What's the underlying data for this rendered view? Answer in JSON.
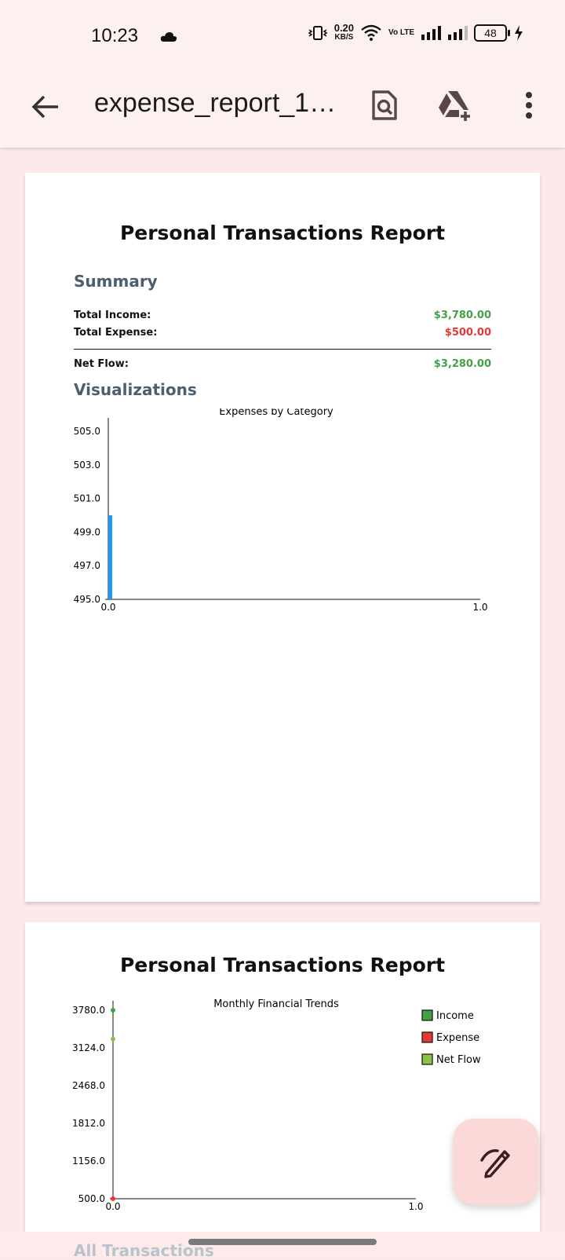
{
  "status_bar": {
    "time": "10:23",
    "net_speed_value": "0.20",
    "net_speed_unit": "KB/S",
    "lte_top": "Vo LTE",
    "battery": "48"
  },
  "toolbar": {
    "title": "expense_report_1…"
  },
  "page1": {
    "title": "Personal Transactions Report",
    "summary_heading": "Summary",
    "rows": [
      {
        "label": "Total Income:",
        "value": "$3,780.00",
        "color": "#43a047"
      },
      {
        "label": "Total Expense:",
        "value": "$500.00",
        "color": "#e53935"
      }
    ],
    "net_label": "Net Flow:",
    "net_value": "$3,280.00",
    "visualizations_heading": "Visualizations"
  },
  "page2": {
    "title": "Personal Transactions Report"
  },
  "next_section_heading": "All Transactions",
  "chart_data": [
    {
      "type": "bar",
      "title": "Expenses by Category",
      "xlabel": "",
      "ylabel": "",
      "x_ticks": [
        "0.0",
        "1.0"
      ],
      "y_ticks": [
        "505.0",
        "503.0",
        "501.0",
        "499.0",
        "497.0",
        "495.0"
      ],
      "xlim": [
        0,
        1
      ],
      "ylim": [
        495,
        505.8
      ],
      "x": [
        0.0
      ],
      "values": [
        500
      ],
      "bar_color": "#2196f3"
    },
    {
      "type": "line",
      "title": "Monthly Financial Trends",
      "xlabel": "",
      "ylabel": "",
      "x_ticks": [
        "0.0",
        "1.0"
      ],
      "y_ticks": [
        "3780.0",
        "3124.0",
        "2468.0",
        "1812.0",
        "1156.0",
        "500.0"
      ],
      "xlim": [
        0,
        1
      ],
      "ylim": [
        500,
        3780
      ],
      "legend_position": "top-right",
      "series": [
        {
          "name": "Income",
          "color": "#43a047",
          "x": [
            0.0
          ],
          "values": [
            3780
          ]
        },
        {
          "name": "Expense",
          "color": "#e53935",
          "x": [
            0.0
          ],
          "values": [
            500
          ]
        },
        {
          "name": "Net Flow",
          "color": "#8bc34a",
          "x": [
            0.0
          ],
          "values": [
            3280
          ]
        }
      ]
    }
  ]
}
